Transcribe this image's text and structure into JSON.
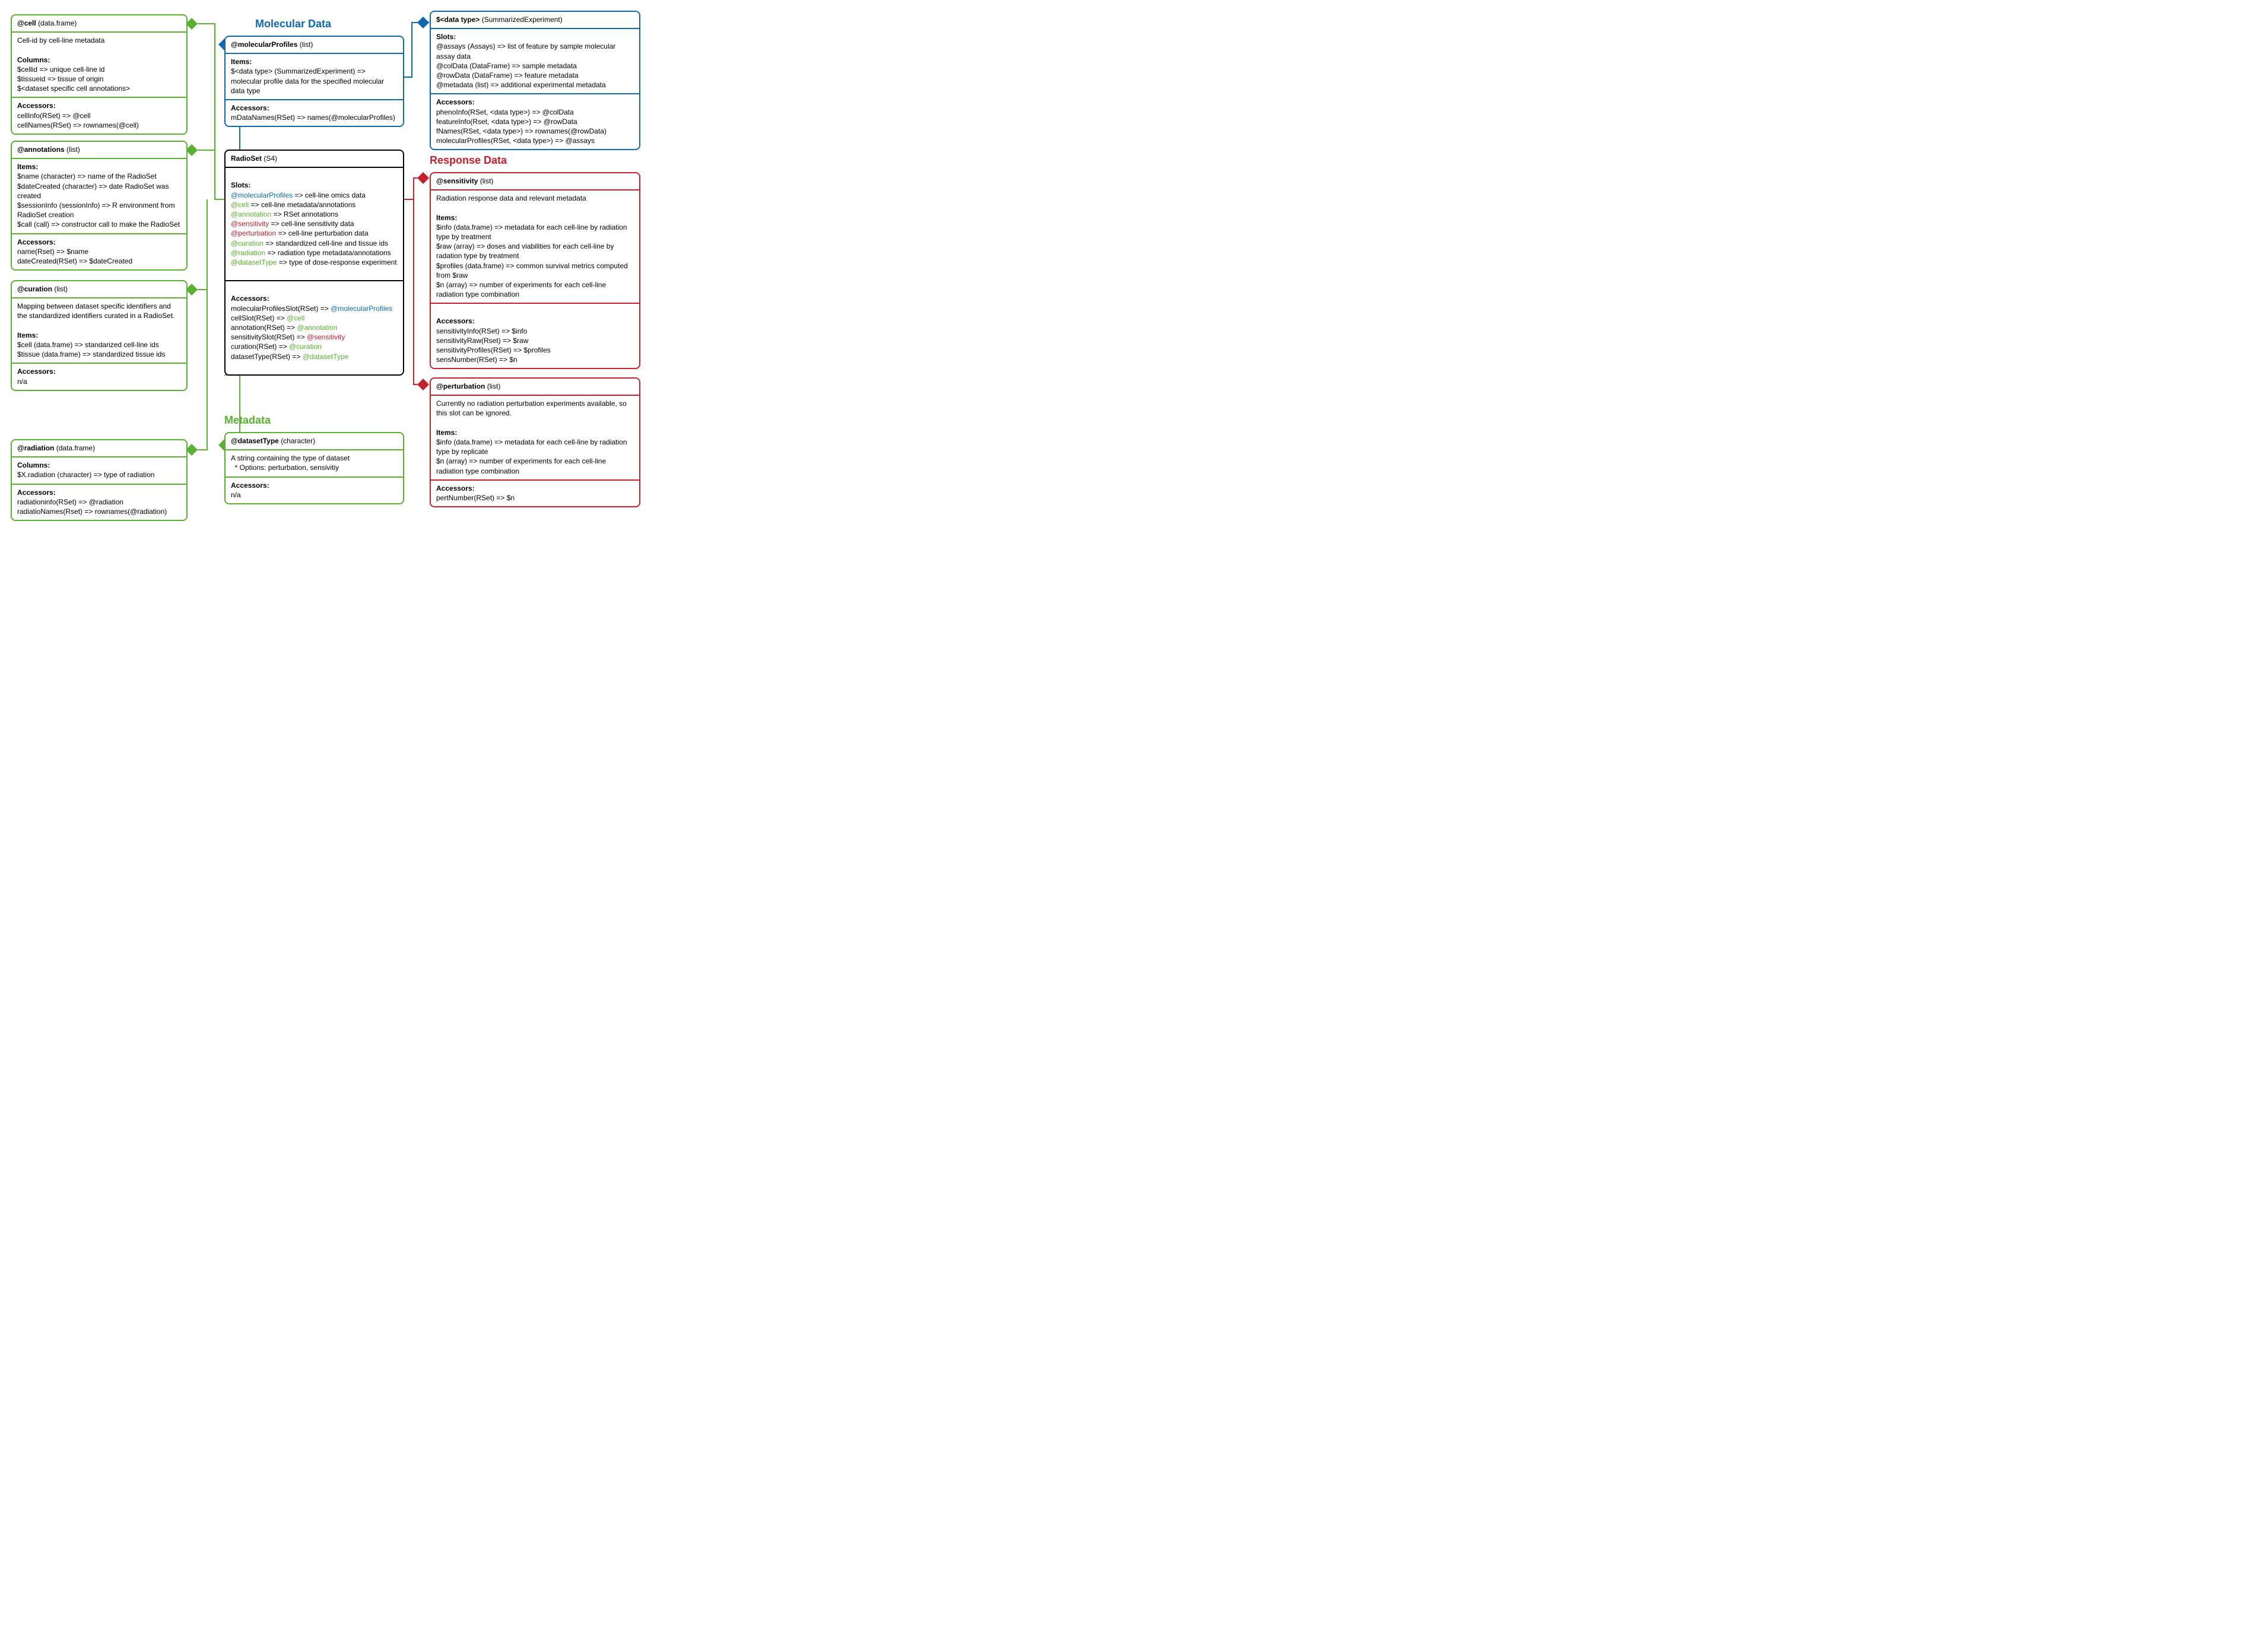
{
  "titles": {
    "molecular": "Molecular Data",
    "response": "Response Data",
    "metadata": "Metadata"
  },
  "cell": {
    "title_slot": "@cell",
    "title_type": "(data.frame)",
    "desc": "Cell-id by cell-line metadata",
    "columns_hdr": "Columns:",
    "col1": "$cellid => unique cell-line id",
    "col2": "$tissueid => tissue of origin",
    "col3": "$<dataset specific cell annotations>",
    "accessors_hdr": "Accessors:",
    "acc1": "cellInfo(RSet) => @cell",
    "acc2": "cellNames(RSet) =>  rownames(@cell)"
  },
  "annot": {
    "title_slot": "@annotations",
    "title_type": "(list)",
    "items_hdr": "Items:",
    "i1": "$name (character) => name of the RadioSet",
    "i2": "$dateCreated (character) => date RadioSet was created",
    "i3": "$sessionInfo (sessionInfo) => R environment from RadioSet creation",
    "i4": "$call (call) => constructor call to make the RadioSet",
    "accessors_hdr": "Accessors:",
    "acc1": "name(Rset) => $name",
    "acc2": "dateCreated(RSet) => $dateCreated"
  },
  "curation": {
    "title_slot": "@curation",
    "title_type": "(list)",
    "desc": "Mapping between dataset specific identifiers and the standardized identifiers curated in a RadioSet.",
    "items_hdr": "Items:",
    "i1": "$cell (data.frame) => standarized cell-line ids",
    "i2": "$tissue (data.frame) => standardized tissue ids",
    "accessors_hdr": "Accessors:",
    "acc1": "n/a"
  },
  "radiation": {
    "title_slot": "@radiation",
    "title_type": "(data.frame)",
    "columns_hdr": "Columns:",
    "c1": "$X.radiation (character) => type of radiation",
    "accessors_hdr": "Accessors:",
    "a1": "radiationinfo(RSet) => @radiation",
    "a2": "radiatioNames(Rset) => rownames(@radiation)"
  },
  "molprof": {
    "title_slot": "@molecularProfiles",
    "title_type": "(list)",
    "items_hdr": "Items:",
    "i1": "$<data type> (SummarizedExperiment)  => molecular profile data for the specified  molecular data type",
    "accessors_hdr": "Accessors:",
    "a1": "mDataNames(RSet) => names(@molecularProfiles)"
  },
  "sumexp": {
    "title_slot": "$<data type>",
    "title_type": "(SummarizedExperiment)",
    "slots_hdr": "Slots:",
    "s1": "@assays (Assays) => list of feature by sample molecular assay data",
    "s2": "@colData (DataFrame) => sample metadata",
    "s3": "@rowData (DataFrame) => feature metadata",
    "s4": "@metadata (list)  => additional experimental metadata",
    "accessors_hdr": "Accessors:",
    "a1": "phenoInfo(RSet, <data type>) => @colData",
    "a2": "featureInfo(Rset, <data type>) => @rowData",
    "a3": "fNames(RSet, <data type>) =>  rownames(@rowData)",
    "a4": "molecularProfiles(RSet, <data type>) => @assays"
  },
  "radioset": {
    "title_slot": "RadioSet",
    "title_type": "(S4)",
    "slots_hdr": "Slots:",
    "s_mp_k": "@molecularProfiles",
    "s_mp_v": " => cell-line omics data",
    "s_cell_k": "@cell",
    "s_cell_v": " => cell-line metadata/annotations",
    "s_ann_k": "@annotation",
    "s_ann_v": " => RSet annotations",
    "s_sens_k": "@sensitivity",
    "s_sens_v": " => cell-line sensitivity data",
    "s_pert_k": "@perturbation",
    "s_pert_v": " => cell-line perturbation data",
    "s_cur_k": "@curation",
    "s_cur_v": " => standardized cell-line and tissue ids",
    "s_rad_k": "@radiation",
    "s_rad_v": " => radiation type metadata/annotations",
    "s_dt_k": "@datasetType",
    "s_dt_v": " => type of dose-response experiment",
    "accessors_hdr": "Accessors:",
    "a1a": "molecularProfilesSlot(RSet) => ",
    "a1b": "@molecularProfiles",
    "a2a": "cellSlot(RSet) => ",
    "a2b": "@cell",
    "a3a": "annotation(RSet) => ",
    "a3b": "@annotation",
    "a4a": "sensitivitySlot(RSet) => ",
    "a4b": "@sensitivity",
    "a5a": "curation(RSet) => ",
    "a5b": "@curation",
    "a6a": "datasetType(RSet) => ",
    "a6b": "@datasetType"
  },
  "dataset": {
    "title_slot": "@datasetType",
    "title_type": "(character)",
    "desc1": "A string containing the type of dataset",
    "desc2": "  * Options: perturbation, sensivitiy",
    "accessors_hdr": "Accessors:",
    "a1": "n/a"
  },
  "sens": {
    "title_slot": "@sensitivity",
    "title_type": "(list)",
    "desc": "Radiation response data and relevant metadata",
    "items_hdr": "Items:",
    "i1": "$info (data.frame) => metadata for each cell-line by radiation type by treatment",
    "i2": "$raw (array) => doses and viabilities for each cell-line by radation type by treatment",
    "i3": "$profiles (data.frame) => common survival metrics computed from $raw",
    "i4": "$n (array) => number of experiments for each cell-line radiation type combination",
    "accessors_hdr": "Accessors:",
    "a1": "sensitivityInfo(RSet) => $info",
    "a2": "sensitivityRaw(Rset) => $raw",
    "a3": "sensitivityProfiles(RSet) => $profiles",
    "a4": "sensNumber(RSet) => $n"
  },
  "pert": {
    "title_slot": "@perturbation",
    "title_type": "(list)",
    "desc": "Currently no radiation perturbation experiments available, so this slot can be ignored.",
    "items_hdr": "Items:",
    "i1": "$info (data.frame) => metadata for each cell-line by radiation type by replicate",
    "i2": "$n (array) => number of experiments for each cell-line radiation type combination",
    "accessors_hdr": "Accessors:",
    "a1": "pertNumber(RSet) => $n"
  }
}
